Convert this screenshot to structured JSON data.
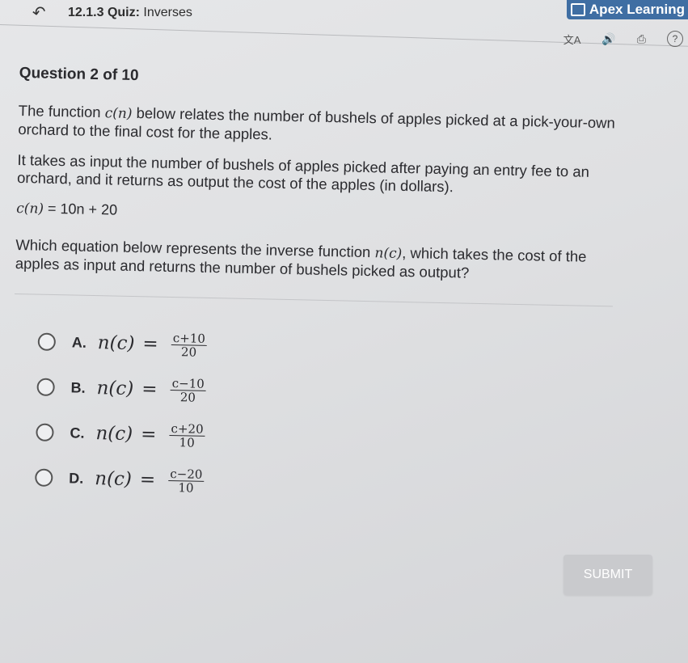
{
  "header": {
    "back_icon": "back-arrow-icon",
    "quiz_code": "12.1.3",
    "quiz_label": "Quiz:",
    "quiz_name": "Inverses",
    "brand": "Apex Learning",
    "toolbar": {
      "translate_icon": "translate-icon",
      "audio_icon": "audio-icon",
      "print_icon": "print-icon",
      "help_icon": "help-icon",
      "help_glyph": "?"
    }
  },
  "question": {
    "number_label": "Question 2 of 10",
    "para1_a": "The function ",
    "para1_fn": "c(n)",
    "para1_b": " below relates the number of bushels of apples picked at a pick-your-own orchard to the final cost for the apples.",
    "para2": "It takes as input the number of bushels of apples picked after paying an entry fee to an orchard, and it returns as output the cost of the apples (in dollars).",
    "equation_fn": "c(n)",
    "equation_rhs": " = 10n + 20",
    "para3_a": "Which equation below represents the inverse function ",
    "para3_fn": "n(c)",
    "para3_b": ", which takes the cost of the apples as input and returns the number of bushels picked as output?"
  },
  "options": [
    {
      "letter": "A.",
      "lhs": "n(c)",
      "eq": "=",
      "num": "c+10",
      "den": "20"
    },
    {
      "letter": "B.",
      "lhs": "n(c)",
      "eq": "=",
      "num": "c−10",
      "den": "20"
    },
    {
      "letter": "C.",
      "lhs": "n(c)",
      "eq": "=",
      "num": "c+20",
      "den": "10"
    },
    {
      "letter": "D.",
      "lhs": "n(c)",
      "eq": "=",
      "num": "c−20",
      "den": "10"
    }
  ],
  "submit_label": "SUBMIT"
}
